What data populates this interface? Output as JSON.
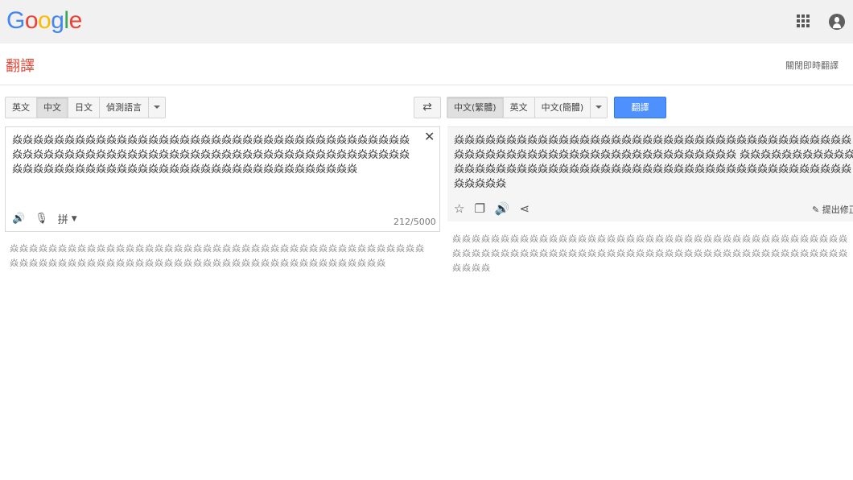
{
  "header": {
    "logo_letters": [
      {
        "char": "G",
        "color": "#4285F4"
      },
      {
        "char": "o",
        "color": "#EA4335"
      },
      {
        "char": "o",
        "color": "#FBBC05"
      },
      {
        "char": "g",
        "color": "#4285F4"
      },
      {
        "char": "l",
        "color": "#34A853"
      },
      {
        "char": "e",
        "color": "#EA4335"
      }
    ]
  },
  "title": "翻譯",
  "instant_toggle": "關閉即時翻譯",
  "source_langs": [
    "英文",
    "中文",
    "日文",
    "偵測語言"
  ],
  "source_selected": "中文",
  "target_langs": [
    "中文(繁體)",
    "英文",
    "中文(簡體)"
  ],
  "target_selected": "中文(繁體)",
  "translate_button": "翻譯",
  "source_text": "焱焱焱焱焱焱焱焱焱焱焱焱焱焱焱焱焱焱焱焱焱焱焱焱焱焱焱焱焱焱焱焱焱焱焱焱焱焱焱焱焱焱焱焱焱焱焱焱焱焱焱焱焱焱焱焱焱焱焱焱焱焱焱焱焱焱焱焱焱焱焱焱焱焱焱焱焱焱焱焱焱焱焱焱焱焱焱焱焱焱焱焱焱焱焱焱焱焱焱焱焱焱焱焱焱焱焱焱焱",
  "char_count": "212/5000",
  "ime_label": "拼",
  "result_text": "焱焱焱焱焱焱焱焱焱焱焱焱焱焱焱焱焱焱焱焱焱焱焱焱焱焱焱焱焱焱焱焱焱焱焱焱焱焱焱焱焱焱焱焱焱焱焱焱焱焱焱焱焱焱焱焱焱焱焱焱焱焱焱焱焱 焱焱焱焱焱焱焱焱焱焱焱焱焱焱焱焱焱焱焱焱焱焱焱焱焱焱焱焱焱焱焱焱焱焱焱焱焱焱焱焱焱焱焱焱焱焱焱焱焱 焱焱焱焱焱",
  "suggest_edit": "提出修正",
  "source_romanization": "焱焱焱焱焱焱焱焱焱焱焱焱焱焱焱焱焱焱焱焱焱焱焱焱焱焱焱焱焱焱焱焱焱焱焱焱焱焱焱焱焱焱焱焱焱焱焱焱焱焱焱焱焱焱焱焱焱焱焱焱焱焱焱焱焱焱焱焱焱焱焱焱焱焱焱焱焱焱焱焱焱焱",
  "result_romanization": "焱焱焱焱焱焱焱焱焱焱焱焱焱焱焱焱焱焱焱焱焱焱焱焱焱焱焱焱焱焱焱焱焱焱焱焱焱焱焱焱焱焱焱焱焱焱焱焱焱焱焱焱焱焱焱焱焱焱焱焱焱焱焱焱焱焱焱焱焱焱焱焱焱焱焱焱焱焱焱焱焱焱焱焱焱焱"
}
